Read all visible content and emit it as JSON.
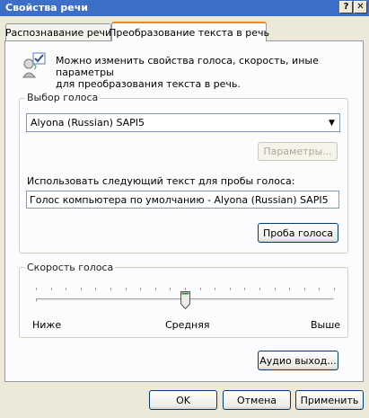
{
  "window": {
    "title": "Свойства речи",
    "help_button": "?",
    "close_button": "✕"
  },
  "tabs": [
    {
      "label": "Распознавание речи"
    },
    {
      "label": "Преобразование текста в речь"
    }
  ],
  "intro": {
    "text_line1": "Можно изменить свойства голоса, скорость, иные параметры",
    "text_line2": "для преобразования текста в речь."
  },
  "voice_group": {
    "label": "Выбор голоса",
    "selected_voice": "Alyona (Russian) SAPI5",
    "settings_button": "Параметры...",
    "preview_label": "Использовать следующий текст для пробы голоса:",
    "preview_text": "Голос компьютера по умолчанию - Alyona (Russian) SAPI5",
    "preview_button": "Проба голоса"
  },
  "speed_group": {
    "label": "Скорость голоса",
    "min_label": "Ниже",
    "mid_label": "Средняя",
    "max_label": "Выше",
    "slider_value_fraction": 0.5
  },
  "audio_output_button": "Аудио выход...",
  "footer": {
    "ok": "OK",
    "cancel": "Отмена",
    "apply": "Применить"
  }
}
